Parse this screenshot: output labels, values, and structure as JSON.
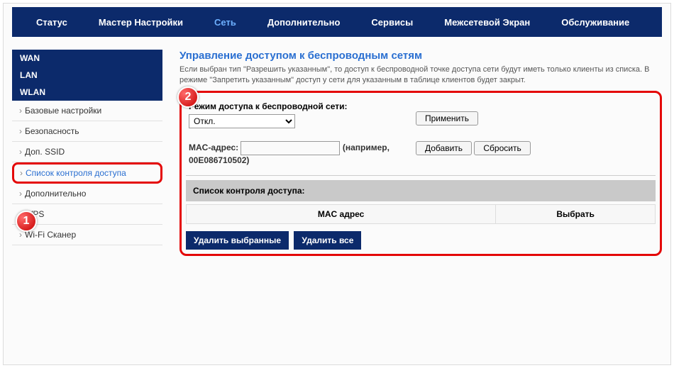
{
  "topnav": {
    "items": [
      "Статус",
      "Мастер Настройки",
      "Сеть",
      "Дополнительно",
      "Сервисы",
      "Межсетевой Экран",
      "Обслуживание"
    ],
    "active_index": 2
  },
  "sidebar": {
    "sections": [
      {
        "title": "WAN",
        "items": []
      },
      {
        "title": "LAN",
        "items": []
      },
      {
        "title": "WLAN",
        "items": [
          "Базовые настройки",
          "Безопасность",
          "Доп. SSID",
          "Список контроля доступа",
          "Дополнительно",
          "WPS",
          "Wi-Fi Сканер"
        ],
        "active_index": 3
      }
    ]
  },
  "content": {
    "title": "Управление доступом к беспроводным сетям",
    "desc": "Если выбран тип \"Разрешить указанным\", то доступ к беспроводной точке доступа сети будут иметь только клиенты из списка. В режиме \"Запретить указанным\" доступ у сети для указанным в таблице клиентов будет закрыт.",
    "mode_label": "Режим доступа к беспроводной сети:",
    "mode_value": "Откл.",
    "apply": "Применить",
    "mac_label": "MAC-адрес:",
    "mac_hint": "(например, 00E086710502)",
    "add": "Добавить",
    "reset": "Сбросить",
    "list_title": "Список контроля доступа:",
    "col_mac": "MAC адрес",
    "col_select": "Выбрать",
    "delete_selected": "Удалить выбранные",
    "delete_all": "Удалить все"
  },
  "badges": {
    "b1": "1",
    "b2": "2"
  }
}
